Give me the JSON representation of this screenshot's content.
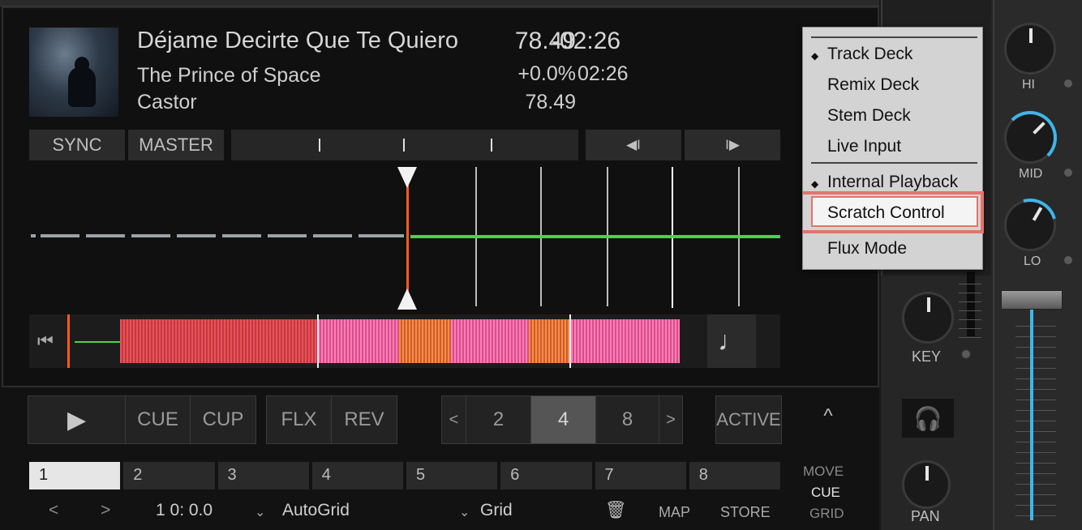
{
  "track": {
    "title": "Déjame Decirte Que Te Quiero",
    "artist": "The Prince of Space",
    "album": "Castor",
    "time_remaining": "-02:26",
    "time_elapsed": "02:26",
    "bpm": "78.49",
    "tempo": "+0.0%",
    "bpm_original": "78.49"
  },
  "deck_buttons": {
    "sync": "SYNC",
    "master": "MASTER",
    "beatjump_back": "◀I",
    "beatjump_fwd": "I▶"
  },
  "overview": {
    "prev_icon": "skip-back-icon",
    "note_icon": "quarter-note-icon"
  },
  "transport": {
    "play_icon": "play-icon",
    "cue": "CUE",
    "cup": "CUP",
    "flx": "FLX",
    "rev": "REV",
    "loop_prev": "<",
    "loop_sizes": [
      "2",
      "4",
      "8"
    ],
    "loop_active_index": 1,
    "loop_next": ">",
    "active": "ACTIVE",
    "collapse": "^"
  },
  "hotcues": [
    "1",
    "2",
    "3",
    "4",
    "5",
    "6",
    "7",
    "8"
  ],
  "hotcue_active": 0,
  "bottom": {
    "prev": "<",
    "next": ">",
    "position": "1 0: 0.0",
    "autogrid": "AutoGrid",
    "grid": "Grid",
    "trash_icon": "trash-icon",
    "map": "MAP",
    "store": "STORE",
    "move": "MOVE",
    "cue": "CUE",
    "grid_mode": "GRID"
  },
  "mixer": {
    "hi": "HI",
    "mid": "MID",
    "lo": "LO",
    "key": "KEY",
    "pan": "PAN",
    "headphones_icon": "headphones-icon",
    "eq_hi": 0.5,
    "eq_mid": 0.72,
    "eq_lo": 0.66
  },
  "menu": {
    "items": [
      "Track Deck",
      "Remix Deck",
      "Stem Deck",
      "Live Input",
      "Internal Playback",
      "Scratch Control",
      "Flux Mode"
    ],
    "checked": [
      "Track Deck",
      "Internal Playback"
    ],
    "highlighted": "Scratch Control"
  },
  "colors": {
    "accent_blue": "#3fb6ea",
    "playhead": "#ff5a1f",
    "highlight": "#e5746b"
  }
}
